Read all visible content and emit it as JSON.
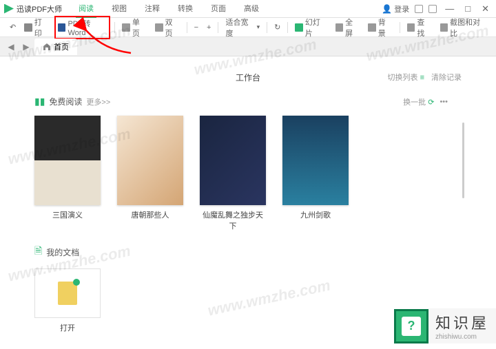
{
  "app": {
    "title": "迅读PDF大师"
  },
  "tabs": [
    "阅读",
    "视图",
    "注释",
    "转换",
    "页面",
    "高级"
  ],
  "active_tab_index": 0,
  "titlebar": {
    "login": "登录"
  },
  "toolbar": {
    "print": "打印",
    "pdf2word": "PDF转Word",
    "single": "单页",
    "double": "双页",
    "fitwidth": "适合宽度",
    "slideshow": "幻灯片",
    "fullscreen": "全屏",
    "background": "背景",
    "find": "查找",
    "screenshot": "截图和对比"
  },
  "tabbar": {
    "home": "首页"
  },
  "workspace": {
    "title": "工作台",
    "switch_list": "切换列表",
    "clear_history": "清除记录"
  },
  "free_read": {
    "title": "免费阅读",
    "more": "更多>>",
    "refresh": "换一批",
    "books": [
      {
        "title": "三国演义"
      },
      {
        "title": "唐朝那些人"
      },
      {
        "title": "仙魔乱舞之独步天下"
      },
      {
        "title": "九州剑歌"
      }
    ]
  },
  "my_docs": {
    "title": "我的文档",
    "open": "打开"
  },
  "watermark": "www.wmzhe.com",
  "brand": {
    "name": "知识屋",
    "domain": "zhishiwu.com"
  }
}
